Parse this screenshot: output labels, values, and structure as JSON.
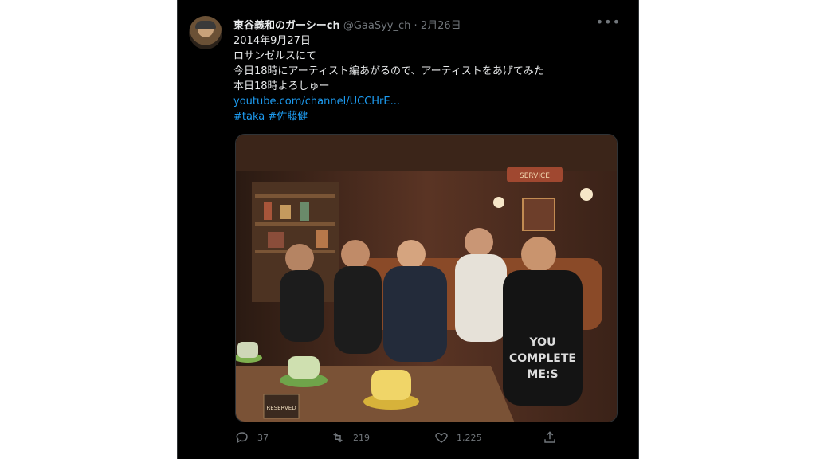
{
  "tweet": {
    "display_name": "東谷義和のガーシーch",
    "handle": "@GaaSyy_ch",
    "separator": "·",
    "date": "2月26日",
    "more_icon": "more-icon",
    "lines": [
      "2014年9月27日",
      "ロサンゼルスにて",
      "今日18時にアーティスト編あがるので、アーティストをあげてみた",
      "本日18時よろしゅー"
    ],
    "link_text": "youtube.com/channel/UCCHrE...",
    "hashtag_1": "#taka",
    "hashtag_2": "#佐藤健",
    "photo_text": {
      "shirt_text_line1": "YOU",
      "shirt_text_line2": "COMPLETE",
      "shirt_text_line3": "ME:S",
      "sign_text": "RESERVED",
      "wall_sign": "SERVICE"
    },
    "actions": {
      "reply_count": "37",
      "retweet_count": "219",
      "like_count": "1,225"
    },
    "colors": {
      "background": "#000000",
      "text": "#e7e9ea",
      "muted": "#71767b",
      "link": "#1d9bf0"
    }
  }
}
